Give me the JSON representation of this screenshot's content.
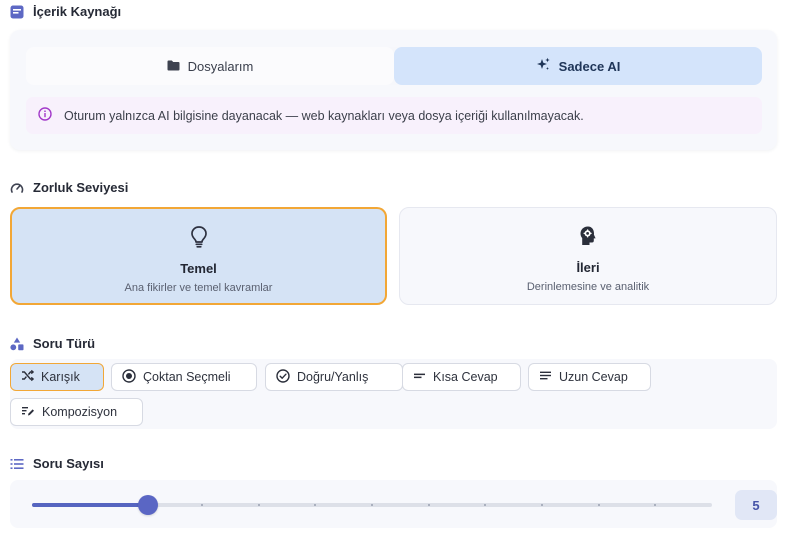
{
  "source": {
    "title": "İçerik Kaynağı",
    "options": [
      "Dosyalarım",
      "Sadece AI"
    ],
    "selected": "Sadece AI",
    "info": "Oturum yalnızca AI bilgisine dayanacak — web kaynakları veya dosya içeriği kullanılmayacak."
  },
  "difficulty": {
    "title": "Zorluk Seviyesi",
    "levels": [
      {
        "name": "Temel",
        "description": "Ana fikirler ve temel kavramlar"
      },
      {
        "name": "İleri",
        "description": "Derinlemesine ve analitik"
      }
    ],
    "selected": "Temel"
  },
  "question_type": {
    "title": "Soru Türü",
    "options": [
      "Karışık",
      "Çoktan Seçmeli",
      "Doğru/Yanlış",
      "Kısa Cevap",
      "Uzun Cevap",
      "Kompozisyon"
    ],
    "selected": "Karışık"
  },
  "question_count": {
    "title": "Soru Sayısı",
    "value": "5",
    "slider_fraction": 0.17
  },
  "colors": {
    "accent": "#5a66c4",
    "selected_bg": "#d5e3f5",
    "selected_border": "#f2a736",
    "info_icon": "#a239c9"
  },
  "icons": {
    "source": "document-list-icon",
    "folder": "folder-icon",
    "ai": "sparkles-icon",
    "info": "info-circle-icon",
    "difficulty": "gauge-icon",
    "basic": "lightbulb-icon",
    "advanced": "head-gear-icon",
    "question_type": "shapes-icon",
    "count": "list-icon"
  }
}
